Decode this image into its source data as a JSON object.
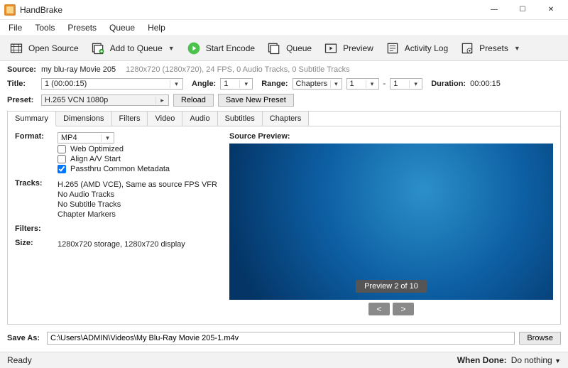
{
  "app": {
    "title": "HandBrake"
  },
  "menu": {
    "file": "File",
    "tools": "Tools",
    "presets": "Presets",
    "queue": "Queue",
    "help": "Help"
  },
  "toolbar": {
    "open_source": "Open Source",
    "add_queue": "Add to Queue",
    "start_encode": "Start Encode",
    "queue": "Queue",
    "preview": "Preview",
    "activity_log": "Activity Log",
    "presets": "Presets"
  },
  "source": {
    "label": "Source:",
    "name": "my blu-ray Movie 205",
    "meta": "1280x720 (1280x720), 24 FPS, 0 Audio Tracks, 0 Subtitle Tracks"
  },
  "titlebar_row": {
    "title_label": "Title:",
    "title_value": "1  (00:00:15)",
    "angle_label": "Angle:",
    "angle_value": "1",
    "range_label": "Range:",
    "range_mode": "Chapters",
    "range_from": "1",
    "range_dash": "-",
    "range_to": "1",
    "duration_label": "Duration:",
    "duration_value": "00:00:15"
  },
  "preset": {
    "label": "Preset:",
    "value": "H.265 VCN 1080p",
    "reload": "Reload",
    "save_new": "Save New Preset"
  },
  "tabs": {
    "summary": "Summary",
    "dimensions": "Dimensions",
    "filters": "Filters",
    "video": "Video",
    "audio": "Audio",
    "subtitles": "Subtitles",
    "chapters": "Chapters"
  },
  "summary": {
    "format_label": "Format:",
    "format_value": "MP4",
    "web_optimized": "Web Optimized",
    "align_av": "Align A/V Start",
    "passthru": "Passthru Common Metadata",
    "tracks_label": "Tracks:",
    "tracks_line1": "H.265 (AMD VCE), Same as source FPS VFR",
    "tracks_line2": "No Audio Tracks",
    "tracks_line3": "No Subtitle Tracks",
    "tracks_line4": "Chapter Markers",
    "filters_label": "Filters:",
    "size_label": "Size:",
    "size_value": "1280x720 storage, 1280x720 display",
    "preview_label": "Source Preview:",
    "preview_counter": "Preview 2 of 10",
    "prev": "<",
    "next": ">"
  },
  "saveas": {
    "label": "Save As:",
    "path": "C:\\Users\\ADMIN\\Videos\\My Blu-Ray Movie 205-1.m4v",
    "browse": "Browse"
  },
  "status": {
    "ready": "Ready",
    "when_done_label": "When Done:",
    "when_done_value": "Do nothing"
  }
}
